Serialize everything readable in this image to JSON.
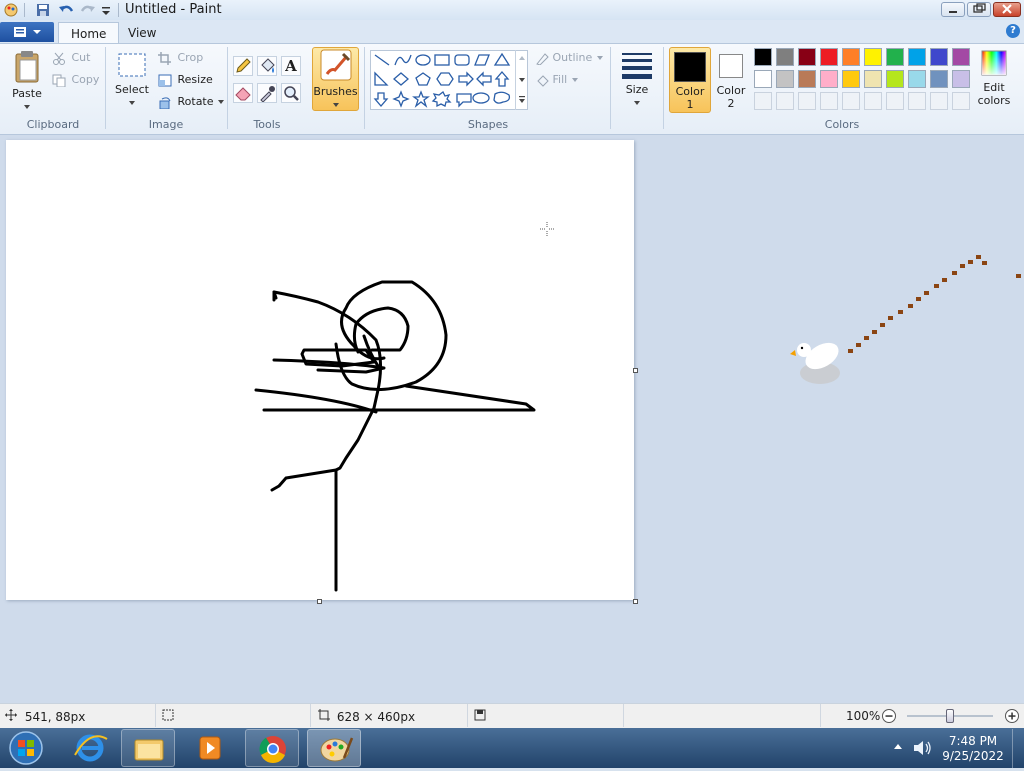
{
  "window": {
    "title": "Untitled - Paint"
  },
  "tabs": [
    {
      "label": "Home"
    },
    {
      "label": "View"
    }
  ],
  "clipboard": {
    "paste": "Paste",
    "cut": "Cut",
    "copy": "Copy",
    "group": "Clipboard"
  },
  "image": {
    "select": "Select",
    "crop": "Crop",
    "resize": "Resize",
    "rotate": "Rotate",
    "group": "Image"
  },
  "tools": {
    "group": "Tools",
    "items": [
      "pencil-icon",
      "fill-icon",
      "text-icon",
      "eraser-icon",
      "color-picker-icon",
      "magnifier-icon"
    ]
  },
  "brushes": {
    "label": "Brushes"
  },
  "shapes": {
    "group": "Shapes",
    "outline": "Outline",
    "fill": "Fill"
  },
  "size": {
    "label": "Size"
  },
  "colors": {
    "color1": {
      "line1": "Color",
      "line2": "1",
      "value": "#000000"
    },
    "color2": {
      "line1": "Color",
      "line2": "2",
      "value": "#ffffff"
    },
    "group": "Colors",
    "edit_line1": "Edit",
    "edit_line2": "colors",
    "palette_row1": [
      "#000000",
      "#7f7f7f",
      "#880015",
      "#ed1c24",
      "#ff7f27",
      "#fff200",
      "#22b14c",
      "#00a2e8",
      "#3f48cc",
      "#a349a4"
    ],
    "palette_row2": [
      "#ffffff",
      "#c3c3c3",
      "#b97a57",
      "#ffaec9",
      "#ffc90e",
      "#efe4b0",
      "#b5e61d",
      "#99d9ea",
      "#7092be",
      "#c8bfe7"
    ]
  },
  "status": {
    "cursor_pos": "541, 88px",
    "canvas_size": "628 × 460px",
    "zoom": "100%"
  },
  "taskbar": {
    "time": "7:48 PM",
    "date": "9/25/2022"
  },
  "accent": "#4a8fd6"
}
